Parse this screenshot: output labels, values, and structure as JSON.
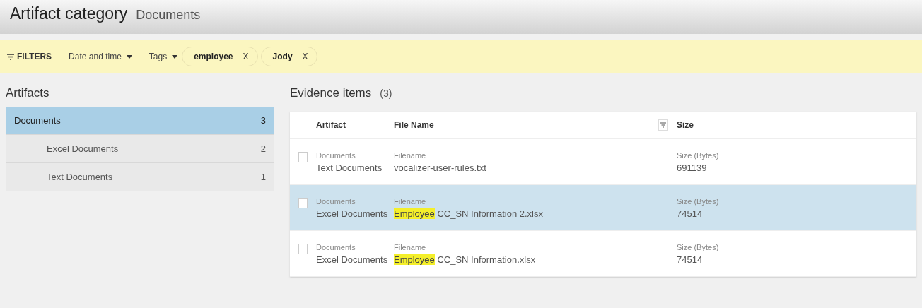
{
  "header": {
    "title": "Artifact category",
    "subtitle": "Documents"
  },
  "filters": {
    "label": "FILTERS",
    "dropdowns": [
      "Date and time",
      "Tags"
    ],
    "chips": [
      {
        "label": "employee",
        "remove": "X"
      },
      {
        "label": "Jody",
        "remove": "X"
      }
    ]
  },
  "artifacts": {
    "title": "Artifacts",
    "items": [
      {
        "label": "Documents",
        "count": "3",
        "selected": true,
        "children": [
          {
            "label": "Excel Documents",
            "count": "2",
            "selected": false
          },
          {
            "label": "Text Documents",
            "count": "1",
            "selected": false
          }
        ]
      }
    ]
  },
  "evidence": {
    "title": "Evidence items",
    "count": "(3)",
    "columns": [
      "Artifact",
      "File Name",
      "Size"
    ],
    "rows": [
      {
        "selected": false,
        "checked": false,
        "artifact_label": "Documents",
        "artifact": "Text Documents",
        "file_label": "Filename",
        "file_match": "",
        "file_rest": "vocalizer-user-rules.txt",
        "size_label": "Size (Bytes)",
        "size": "691139"
      },
      {
        "selected": true,
        "checked": false,
        "artifact_label": "Documents",
        "artifact": "Excel Documents",
        "file_label": "Filename",
        "file_match": "Employee",
        "file_rest": " CC_SN Information 2.xlsx",
        "size_label": "Size (Bytes)",
        "size": "74514"
      },
      {
        "selected": false,
        "checked": false,
        "artifact_label": "Documents",
        "artifact": "Excel Documents",
        "file_label": "Filename",
        "file_match": "Employee",
        "file_rest": " CC_SN Information.xlsx",
        "size_label": "Size (Bytes)",
        "size": "74514"
      }
    ]
  }
}
